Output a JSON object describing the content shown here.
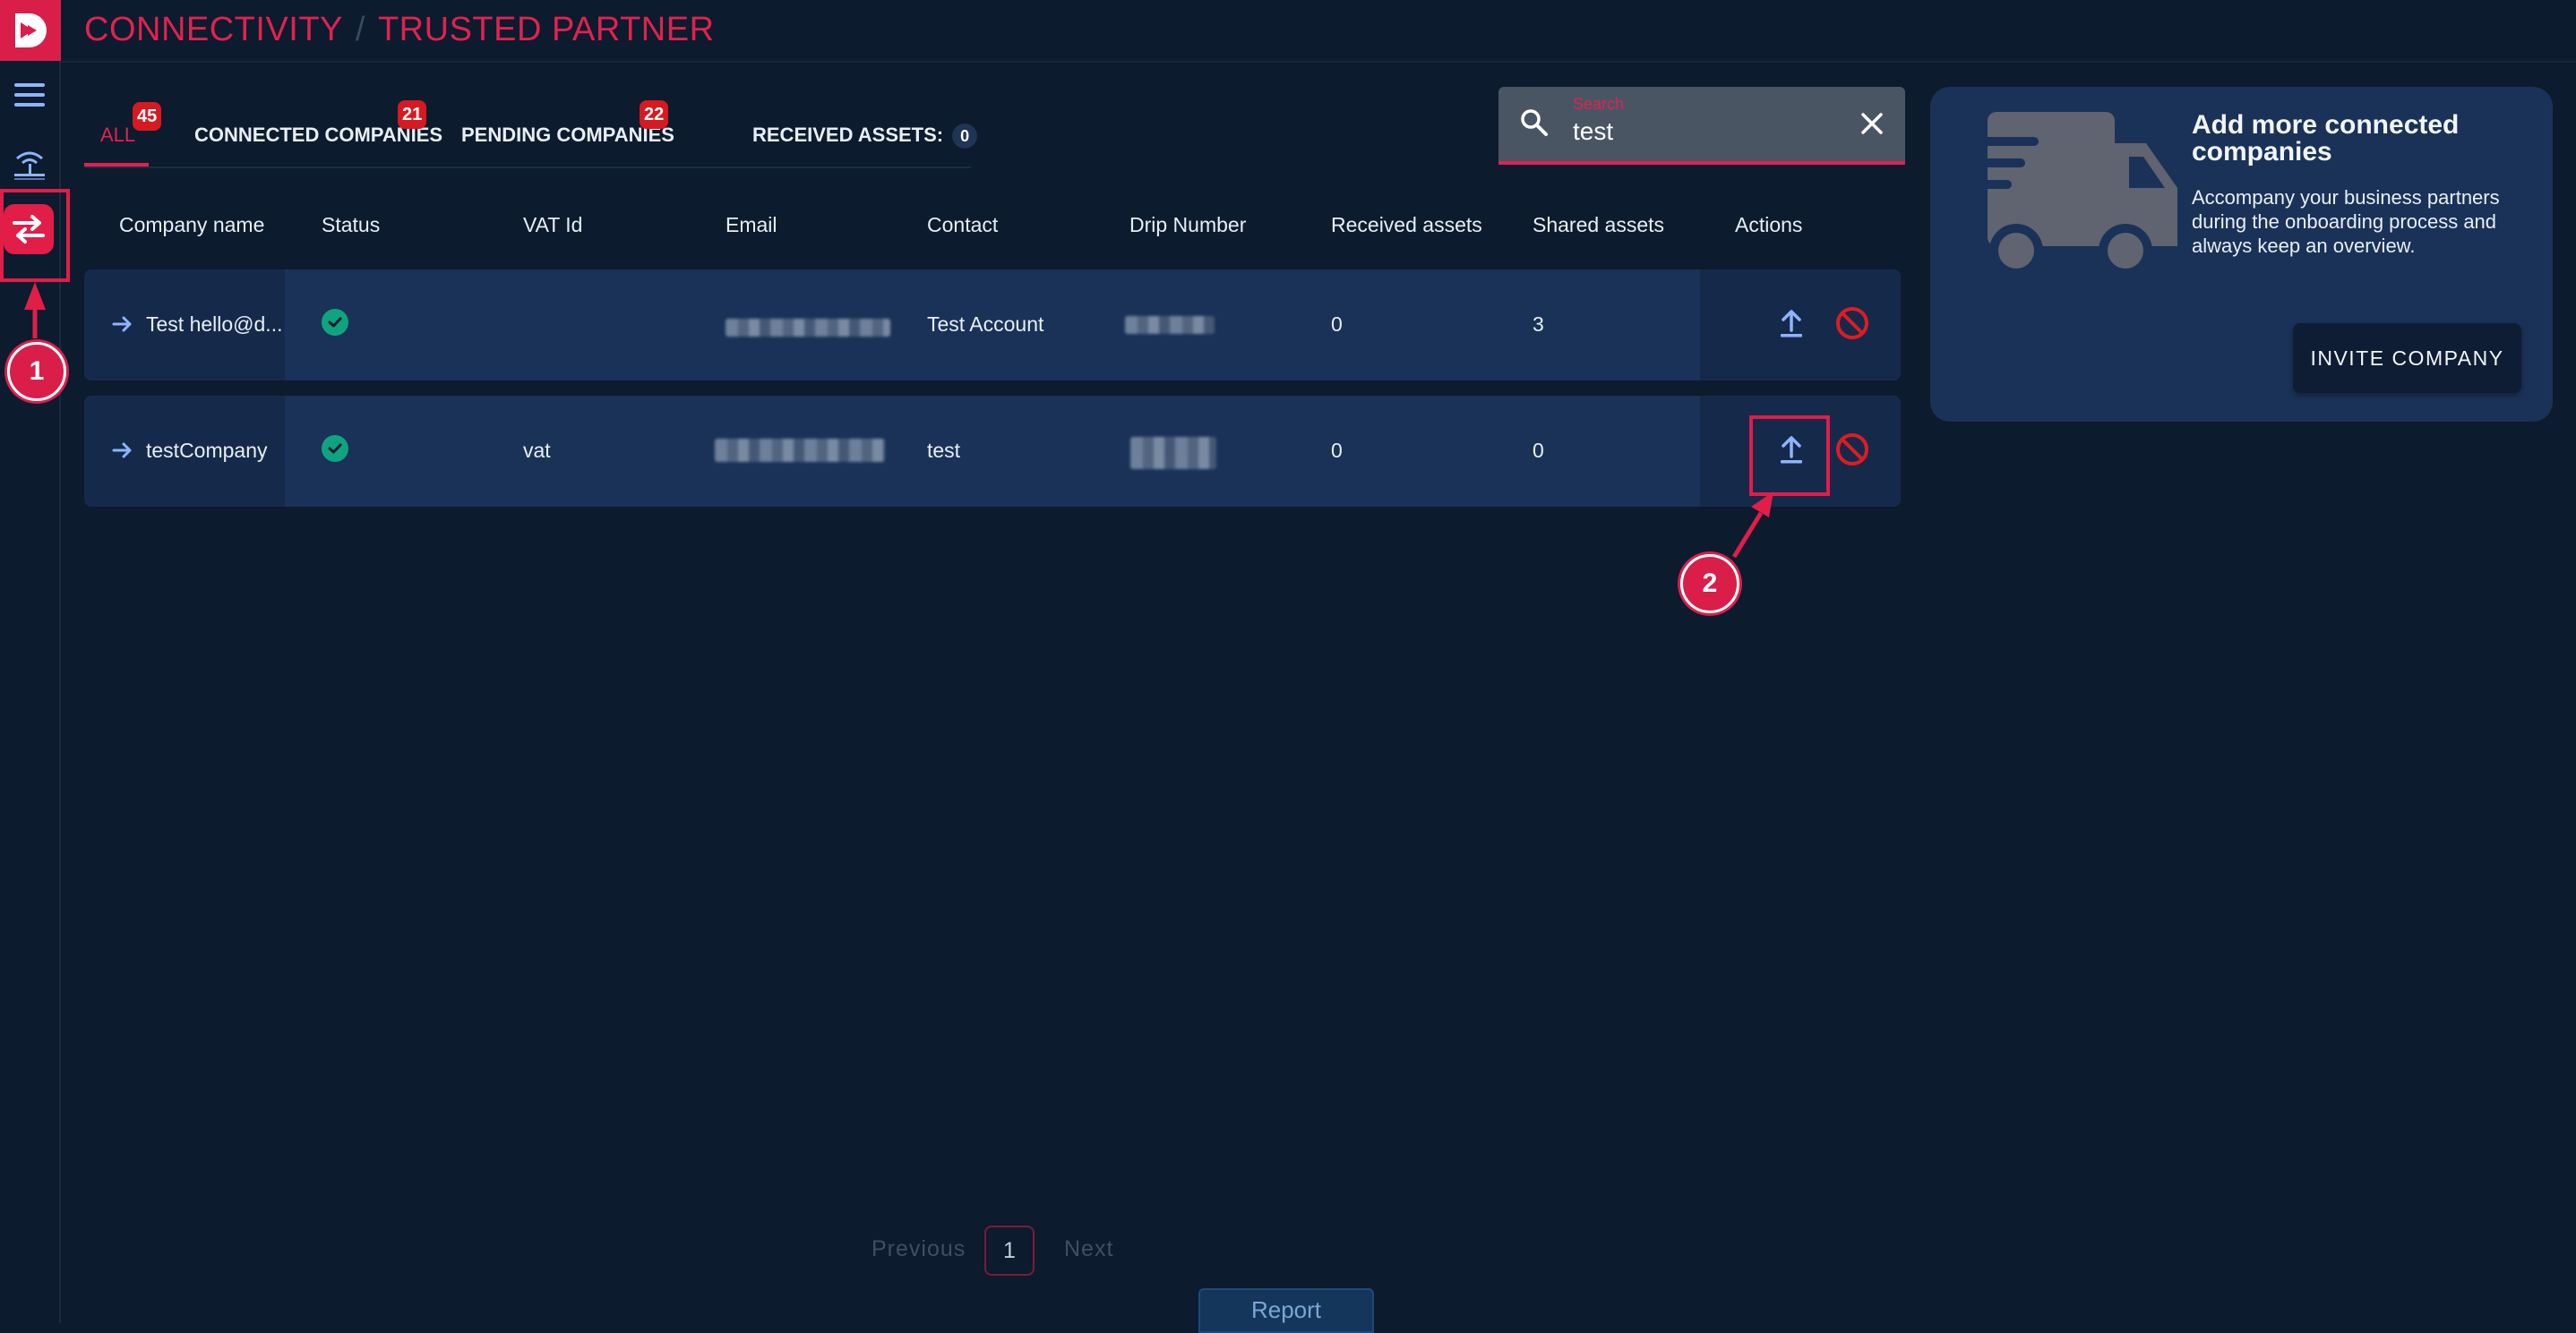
{
  "breadcrumb": {
    "section": "CONNECTIVITY",
    "separator": "/",
    "page": "TRUSTED PARTNER"
  },
  "tabs": [
    {
      "label": "ALL",
      "badge": "45"
    },
    {
      "label": "CONNECTED COMPANIES",
      "badge": "21"
    },
    {
      "label": "PENDING COMPANIES",
      "badge": "22"
    },
    {
      "label": "RECEIVED ASSETS:",
      "count": "0"
    }
  ],
  "search": {
    "label": "Search",
    "value": "test"
  },
  "table": {
    "columns": [
      "Company name",
      "Status",
      "VAT Id",
      "Email",
      "Contact",
      "Drip Number",
      "Received assets",
      "Shared assets",
      "Actions"
    ],
    "rows": [
      {
        "company": "Test hello@d...",
        "status": "connected",
        "vat": "",
        "contact": "Test Account",
        "received": "0",
        "shared": "3"
      },
      {
        "company": "testCompany",
        "status": "connected",
        "vat": "vat",
        "contact": "test",
        "received": "0",
        "shared": "0"
      }
    ]
  },
  "card": {
    "title": "Add more connected companies",
    "text": "Accompany your business partners during the onboarding process and always keep an overview.",
    "button": "INVITE COMPANY"
  },
  "pagination": {
    "previous": "Previous",
    "page": "1",
    "next": "Next"
  },
  "report": "Report",
  "annotations": [
    "1",
    "2"
  ],
  "colors": {
    "accent": "#e0224e",
    "background": "#0c1b2e",
    "row": "#1a3257",
    "success": "#10a37f",
    "danger": "#d71920",
    "action_icon": "#8fb4ff"
  }
}
